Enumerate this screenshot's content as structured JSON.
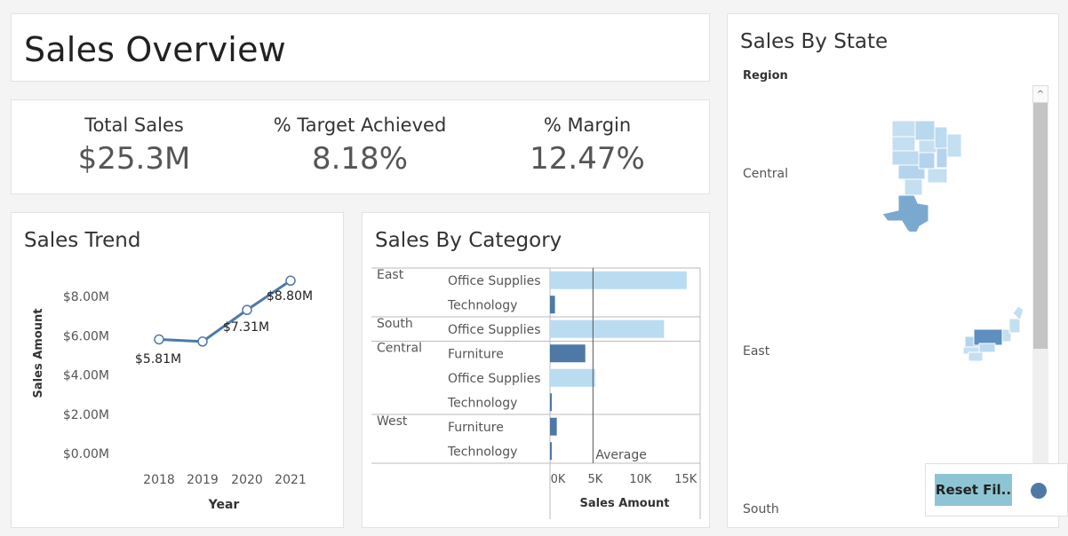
{
  "header": {
    "title": "Sales Overview"
  },
  "kpis": [
    {
      "label": "Total Sales",
      "value": "$25.3M"
    },
    {
      "label": "% Target Achieved",
      "value": "8.18%"
    },
    {
      "label": "% Margin",
      "value": "12.47%"
    }
  ],
  "trend": {
    "title": "Sales Trend",
    "chart_data": {
      "type": "line",
      "x": [
        "2018",
        "2019",
        "2020",
        "2021"
      ],
      "values": [
        5.81,
        5.7,
        7.31,
        8.8
      ],
      "data_labels": [
        "$5.81M",
        "",
        "$7.31M",
        "$8.80M"
      ],
      "y_ticks": [
        "$8.00M",
        "$6.00M",
        "$4.00M",
        "$2.00M",
        "$0.00M"
      ],
      "xlabel": "Year",
      "ylabel": "Sales Amount"
    }
  },
  "category": {
    "title": "Sales By Category",
    "chart_data": {
      "type": "bar",
      "rows": [
        {
          "region": "East",
          "category": "Office Supplies",
          "value": 15100,
          "color": "#b9dcf0"
        },
        {
          "region": "",
          "category": "Technology",
          "value": 550,
          "color": "#4e79a7"
        },
        {
          "region": "South",
          "category": "Office Supplies",
          "value": 12600,
          "color": "#b9dcf0"
        },
        {
          "region": "Central",
          "category": "Furniture",
          "value": 3900,
          "color": "#4e79a7"
        },
        {
          "region": "",
          "category": "Office Supplies",
          "value": 5000,
          "color": "#b9dcf0"
        },
        {
          "region": "",
          "category": "Technology",
          "value": 200,
          "color": "#4e79a7"
        },
        {
          "region": "West",
          "category": "Furniture",
          "value": 750,
          "color": "#4e79a7"
        },
        {
          "region": "",
          "category": "Technology",
          "value": 120,
          "color": "#4e79a7"
        }
      ],
      "average": 4750,
      "average_label": "Average",
      "x_ticks": [
        "0K",
        "5K",
        "10K",
        "15K"
      ],
      "xlim": [
        0,
        16000
      ],
      "xlabel": "Sales Amount"
    }
  },
  "state": {
    "title": "Sales By State",
    "region_header": "Region",
    "regions": [
      "Central",
      "East",
      "South"
    ],
    "scroll_up": "^"
  },
  "reset": {
    "label": "Reset Fil.."
  }
}
